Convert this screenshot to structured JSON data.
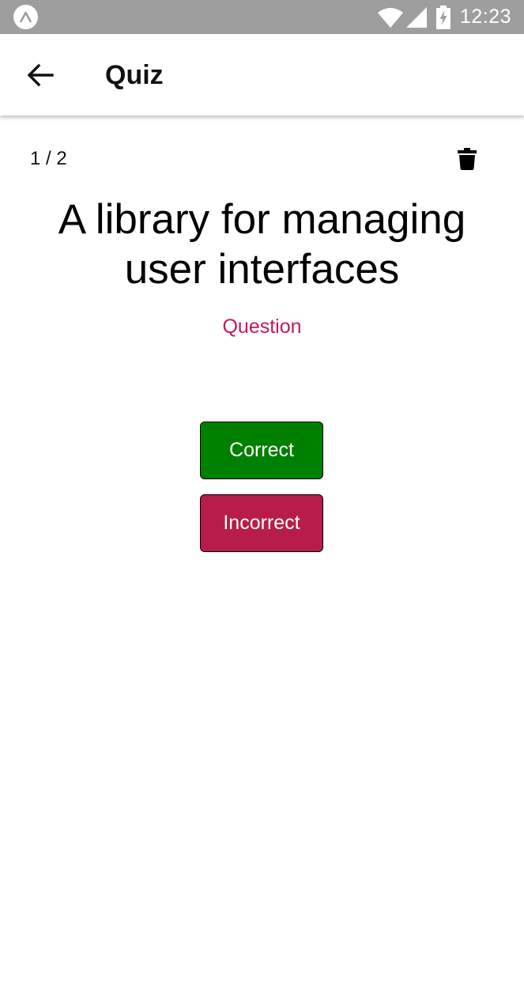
{
  "status_bar": {
    "time": "12:23",
    "icons": [
      "app-icon",
      "wifi-icon",
      "signal-icon",
      "battery-charging-icon"
    ],
    "background": "#9e9e9e"
  },
  "app_bar": {
    "title": "Quiz",
    "back_icon": "arrow-left-icon"
  },
  "quiz": {
    "progress": "1 / 2",
    "delete_icon": "trash-icon",
    "card_text": "A library for managing user interfaces",
    "toggle_label": "Question",
    "toggle_color": "#c2185b",
    "correct_label": "Correct",
    "correct_color": "#008000",
    "incorrect_label": "Incorrect",
    "incorrect_color": "#b71c4a"
  }
}
